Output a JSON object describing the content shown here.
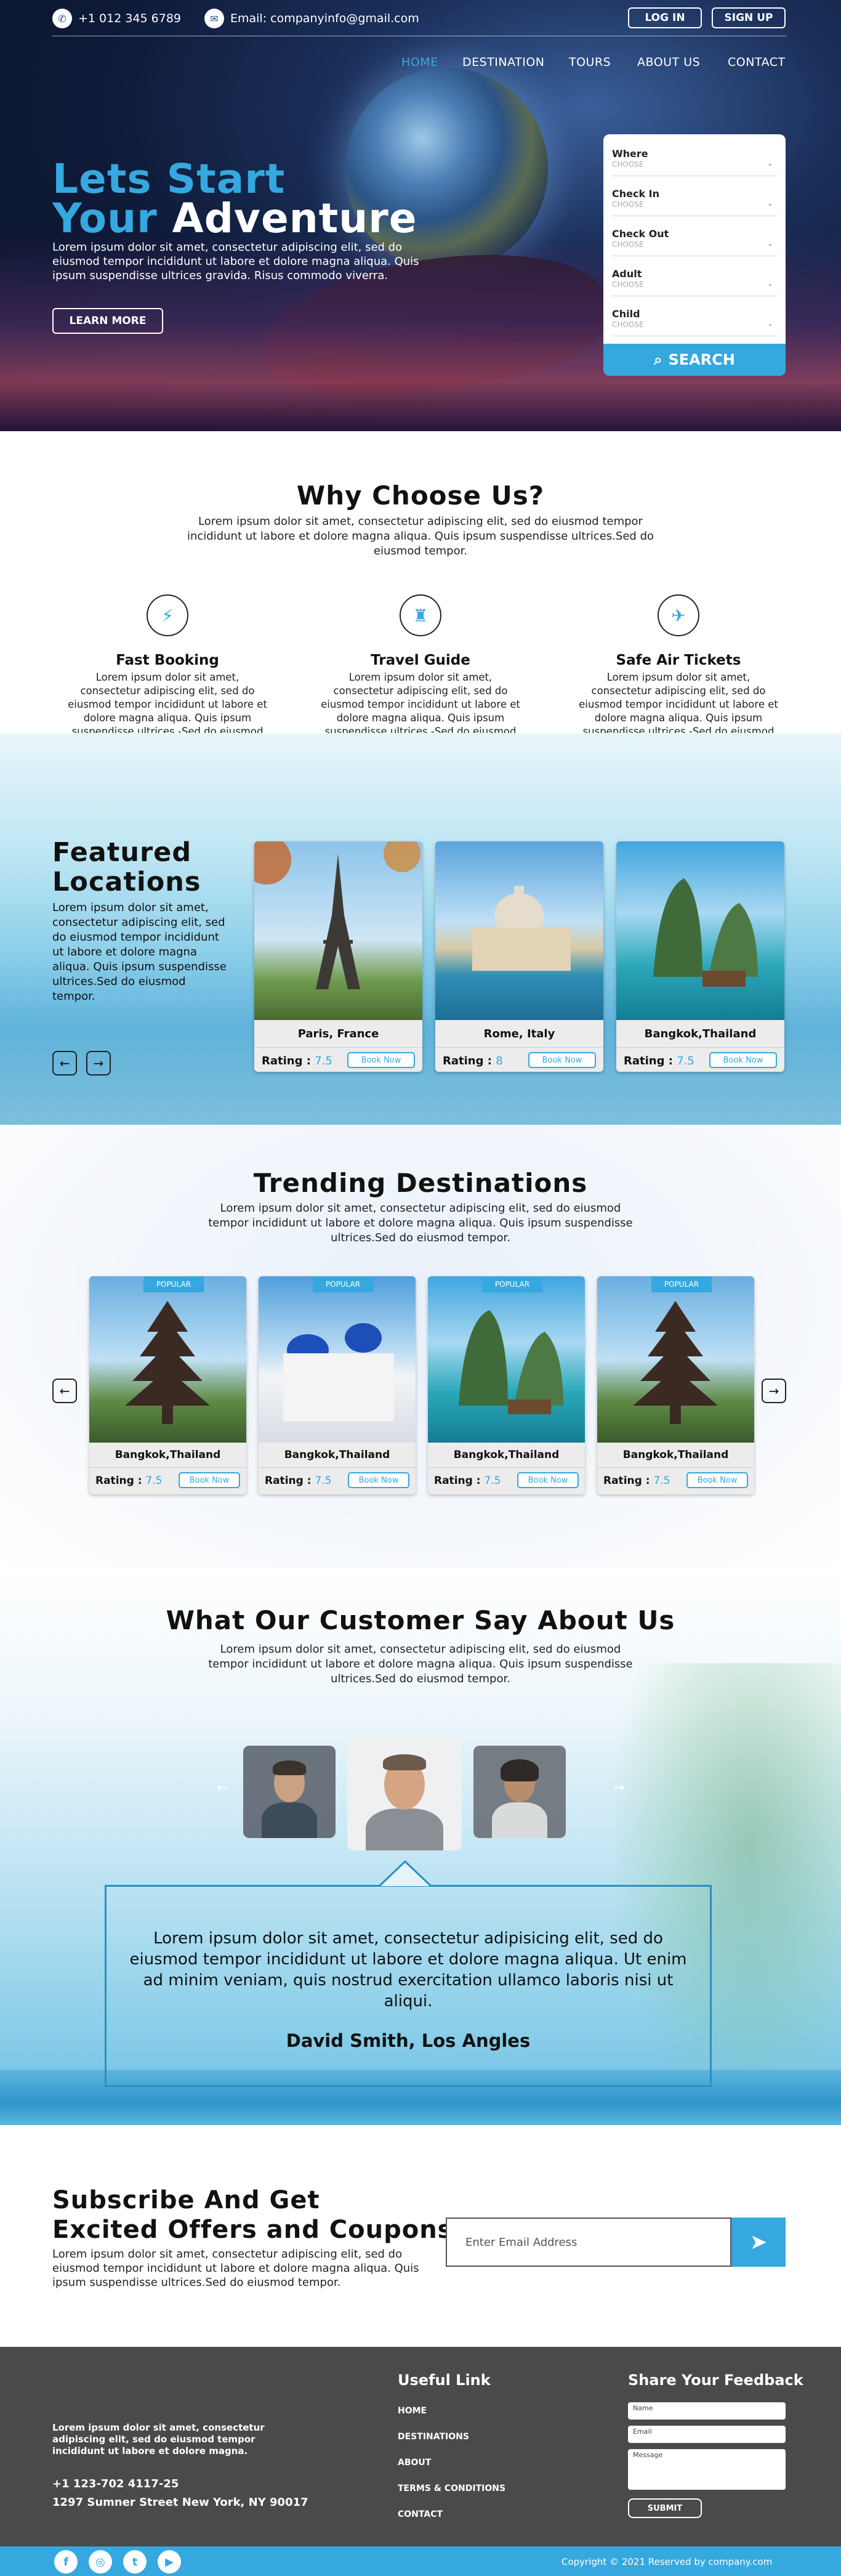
{
  "header": {
    "phone": "+1 012 345 6789",
    "email": "Email: companyinfo@gmail.com",
    "login": "LOG IN",
    "signup": "SIGN UP",
    "nav": [
      "HOME",
      "DESTINATION",
      "TOURS",
      "ABOUT US",
      "CONTACT"
    ]
  },
  "hero": {
    "title_line1": "Lets Start",
    "title_line2_a": "Your",
    "title_line2_b": "Adventure",
    "text": "Lorem ipsum dolor sit amet, consectetur adipiscing elit, sed do eiusmod tempor incididunt ut labore et dolore magna aliqua. Quis ipsum suspendisse ultrices gravida. Risus commodo viverra.",
    "cta": "LEARN MORE"
  },
  "booking": {
    "fields": [
      {
        "label": "Where",
        "value": "CHOOSE"
      },
      {
        "label": "Check In",
        "value": "CHOOSE"
      },
      {
        "label": "Check Out",
        "value": "CHOOSE"
      },
      {
        "label": "Adult",
        "value": "CHOOSE"
      },
      {
        "label": "Child",
        "value": "CHOOSE"
      }
    ],
    "search": "SEARCH"
  },
  "why": {
    "title": "Why Choose Us?",
    "text": "Lorem ipsum dolor sit amet, consectetur adipiscing elit, sed do eiusmod tempor incididunt ut labore et dolore magna aliqua. Quis ipsum suspendisse ultrices.Sed do eiusmod tempor.",
    "features": [
      {
        "title": "Fast Booking",
        "text": "Lorem ipsum dolor sit amet, consectetur adipiscing elit, sed do eiusmod tempor incididunt ut labore et dolore magna aliqua. Quis ipsum suspendisse ultrices.-Sed do eiusmod tempor.",
        "icon": "lightning-icon"
      },
      {
        "title": "Travel Guide",
        "text": "Lorem ipsum dolor sit amet, consectetur adipiscing elit, sed do eiusmod tempor incididunt ut labore et dolore magna aliqua. Quis ipsum suspendisse ultrices.-Sed do eiusmod tempor.",
        "icon": "guide-icon"
      },
      {
        "title": "Safe Air Tickets",
        "text": "Lorem ipsum dolor sit amet, consectetur adipiscing elit, sed do eiusmod tempor incididunt ut labore et dolore magna aliqua. Quis ipsum suspendisse ultrices.-Sed do eiusmod tempor.",
        "icon": "ticket-icon"
      }
    ]
  },
  "featured": {
    "title_line1": "Featured",
    "title_line2": "Locations",
    "text": "Lorem ipsum dolor sit amet, consectetur adipiscing elit, sed do eiusmod tempor incididunt ut labore et dolore magna aliqua. Quis ipsum suspendisse ultrices.Sed do eiusmod tempor.",
    "rating_label": "Rating :",
    "book": "Book Now",
    "cards": [
      {
        "name": "Paris, France",
        "rating": "7.5"
      },
      {
        "name": "Rome, Italy",
        "rating": "8"
      },
      {
        "name": "Bangkok,Thailand",
        "rating": "7.5"
      }
    ]
  },
  "trending": {
    "title": "Trending Destinations",
    "text": "Lorem ipsum dolor sit amet, consectetur adipiscing elit, sed do eiusmod tempor incididunt ut labore et dolore magna aliqua. Quis ipsum suspendisse ultrices.Sed do eiusmod tempor.",
    "badge": "POPULAR",
    "rating_label": "Rating :",
    "book": "Book Now",
    "cards": [
      {
        "name": "Bangkok,Thailand",
        "rating": "7.5"
      },
      {
        "name": "Bangkok,Thailand",
        "rating": "7.5"
      },
      {
        "name": "Bangkok,Thailand",
        "rating": "7.5"
      },
      {
        "name": "Bangkok,Thailand",
        "rating": "7.5"
      }
    ]
  },
  "testimonial": {
    "title": "What Our Customer Say About Us",
    "text": "Lorem ipsum dolor sit amet, consectetur adipiscing elit, sed do eiusmod tempor incididunt ut labore et dolore magna aliqua. Quis ipsum suspendisse ultrices.Sed do eiusmod tempor.",
    "quote": "Lorem ipsum dolor sit amet, consectetur adipisicing elit, sed do eiusmod tempor incididunt ut labore et dolore magna aliqua. Ut enim ad minim veniam, quis nostrud exercitation ullamco laboris nisi ut aliqui.",
    "author": "David Smith, Los Angles"
  },
  "subscribe": {
    "title_line1": "Subscribe And Get",
    "title_line2": "Excited Offers and Coupons",
    "text": "Lorem ipsum dolor sit amet, consectetur adipiscing elit, sed do eiusmod tempor incididunt ut labore et dolore magna aliqua. Quis ipsum suspendisse ultrices.Sed do eiusmod tempor.",
    "placeholder": "Enter Email Address"
  },
  "footer": {
    "about": "Lorem ipsum dolor sit amet, consectetur adipiscing elit, sed do eiusmod tempor incididunt ut labore et dolore magna.",
    "phone": "+1 123-702 4117-25",
    "address": "1297 Sumner Street New York, NY  90017",
    "links_title": "Useful Link",
    "links": [
      "HOME",
      "DESTINATIONS",
      "ABOUT",
      "TERMS & CONDITIONS",
      "CONTACT"
    ],
    "feedback_title": "Share Your Feedback",
    "name_ph": "Name",
    "email_ph": "Email",
    "message_ph": "Message",
    "submit": "SUBMIT",
    "copyright": "Copyright © 2021 Reserved by company.com"
  },
  "colors": {
    "accent": "#35a8df",
    "dark": "#4a4a4a"
  }
}
